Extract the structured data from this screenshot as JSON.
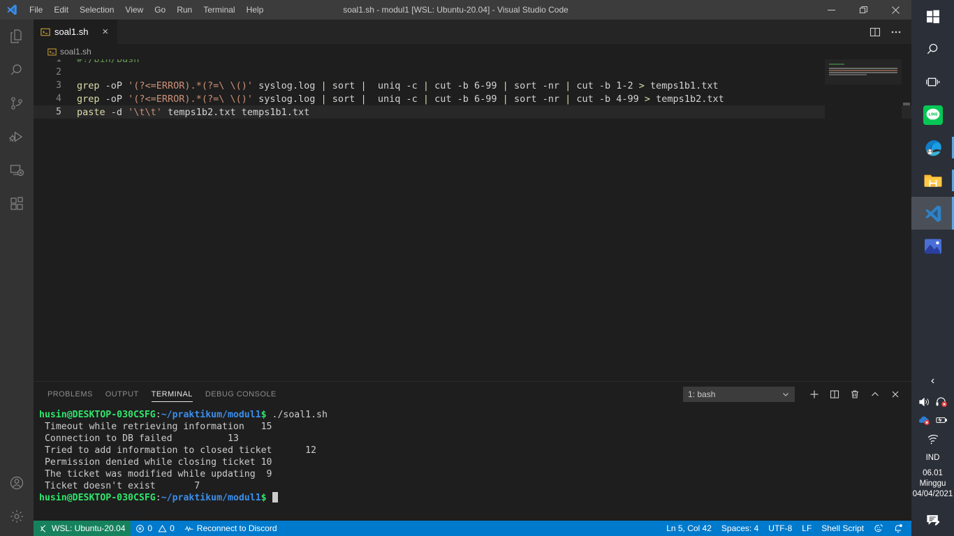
{
  "window": {
    "title": "soal1.sh - modul1 [WSL: Ubuntu-20.04] - Visual Studio Code",
    "minimize_label": "Minimize",
    "maximize_label": "Restore",
    "close_label": "Close"
  },
  "menu": {
    "items": [
      {
        "label": "File"
      },
      {
        "label": "Edit"
      },
      {
        "label": "Selection"
      },
      {
        "label": "View"
      },
      {
        "label": "Go"
      },
      {
        "label": "Run"
      },
      {
        "label": "Terminal"
      },
      {
        "label": "Help"
      }
    ]
  },
  "activity_bar": {
    "items": [
      {
        "name": "explorer-icon",
        "label": "Explorer"
      },
      {
        "name": "search-icon",
        "label": "Search"
      },
      {
        "name": "source-control-icon",
        "label": "Source Control"
      },
      {
        "name": "run-and-debug-icon",
        "label": "Run and Debug"
      },
      {
        "name": "remote-explorer-icon",
        "label": "Remote Explorer"
      },
      {
        "name": "extensions-icon",
        "label": "Extensions"
      }
    ],
    "bottom": [
      {
        "name": "accounts-icon",
        "label": "Accounts"
      },
      {
        "name": "manage-icon",
        "label": "Manage"
      }
    ]
  },
  "tabs": [
    {
      "label": "soal1.sh",
      "icon": "shell-script-icon",
      "close": "×",
      "active": true
    }
  ],
  "editor_actions": {
    "split_label": "Split Editor",
    "more_label": "More Actions..."
  },
  "breadcrumb": {
    "items": [
      {
        "label": "soal1.sh",
        "icon": "shell-script-icon"
      }
    ]
  },
  "code": {
    "language": "Shell Script",
    "lines": [
      {
        "n": "1",
        "current": false,
        "tokens": [
          {
            "t": "#!/bin/bash",
            "c": "k-com"
          }
        ]
      },
      {
        "n": "2",
        "current": false,
        "tokens": [
          {
            "t": "",
            "c": "k-plain"
          }
        ]
      },
      {
        "n": "3",
        "current": false,
        "tokens": [
          {
            "t": "grep",
            "c": "k-cmd"
          },
          {
            "t": " -oP ",
            "c": "k-plain"
          },
          {
            "t": "'(?<=ERROR).*(?=\\ \\()'",
            "c": "k-str"
          },
          {
            "t": " syslog.log ",
            "c": "k-plain"
          },
          {
            "t": "|",
            "c": "k-pipe"
          },
          {
            "t": " sort ",
            "c": "k-plain"
          },
          {
            "t": "|",
            "c": "k-pipe"
          },
          {
            "t": "  uniq -c ",
            "c": "k-plain"
          },
          {
            "t": "|",
            "c": "k-pipe"
          },
          {
            "t": " cut -b 6-99 ",
            "c": "k-plain"
          },
          {
            "t": "|",
            "c": "k-pipe"
          },
          {
            "t": " sort -nr ",
            "c": "k-plain"
          },
          {
            "t": "|",
            "c": "k-pipe"
          },
          {
            "t": " cut -b 1-2 ",
            "c": "k-plain"
          },
          {
            "t": ">",
            "c": "k-pipe"
          },
          {
            "t": " temps1b1.txt",
            "c": "k-plain"
          }
        ]
      },
      {
        "n": "4",
        "current": false,
        "tokens": [
          {
            "t": "grep",
            "c": "k-cmd"
          },
          {
            "t": " -oP ",
            "c": "k-plain"
          },
          {
            "t": "'(?<=ERROR).*(?=\\ \\()'",
            "c": "k-str"
          },
          {
            "t": " syslog.log ",
            "c": "k-plain"
          },
          {
            "t": "|",
            "c": "k-pipe"
          },
          {
            "t": " sort ",
            "c": "k-plain"
          },
          {
            "t": "|",
            "c": "k-pipe"
          },
          {
            "t": "  uniq -c ",
            "c": "k-plain"
          },
          {
            "t": "|",
            "c": "k-pipe"
          },
          {
            "t": " cut -b 6-99 ",
            "c": "k-plain"
          },
          {
            "t": "|",
            "c": "k-pipe"
          },
          {
            "t": " sort -nr ",
            "c": "k-plain"
          },
          {
            "t": "|",
            "c": "k-pipe"
          },
          {
            "t": " cut -b 4-99 ",
            "c": "k-plain"
          },
          {
            "t": ">",
            "c": "k-pipe"
          },
          {
            "t": " temps1b2.txt",
            "c": "k-plain"
          }
        ]
      },
      {
        "n": "5",
        "current": true,
        "tokens": [
          {
            "t": "paste",
            "c": "k-cmd"
          },
          {
            "t": " -d ",
            "c": "k-plain"
          },
          {
            "t": "'\\t\\t'",
            "c": "k-str"
          },
          {
            "t": " temps1b2.txt temps1b1.txt",
            "c": "k-plain"
          }
        ]
      }
    ]
  },
  "panel": {
    "tabs": [
      {
        "label": "PROBLEMS",
        "active": false
      },
      {
        "label": "OUTPUT",
        "active": false
      },
      {
        "label": "TERMINAL",
        "active": true
      },
      {
        "label": "DEBUG CONSOLE",
        "active": false
      }
    ],
    "terminal_select": {
      "value": "1: bash",
      "chevron": "˅"
    },
    "actions": [
      {
        "name": "new-terminal-button",
        "label": "New Terminal"
      },
      {
        "name": "split-terminal-button",
        "label": "Split Terminal"
      },
      {
        "name": "kill-terminal-button",
        "label": "Kill Terminal"
      },
      {
        "name": "maximize-panel-button",
        "label": "Maximize Panel Size"
      },
      {
        "name": "close-panel-button",
        "label": "Close Panel"
      }
    ]
  },
  "terminal": {
    "prompt": {
      "user_host": "husin@DESKTOP-030CSFG",
      "colon": ":",
      "path": "~/praktikum/modul1",
      "dollar": "$"
    },
    "command": " ./soal1.sh",
    "output_lines": [
      " Timeout while retrieving information\t15",
      " Connection to DB failed\t\t13",
      " Tried to add information to closed ticket\t12",
      " Permission denied while closing ticket\t10",
      " The ticket was modified while updating\t9",
      " Ticket doesn't exist\t\t7"
    ],
    "output_rendered": [
      " Timeout while retrieving information   15",
      " Connection to DB failed          13",
      " Tried to add information to closed ticket      12",
      " Permission denied while closing ticket 10",
      " The ticket was modified while updating  9",
      " Ticket doesn't exist       7"
    ]
  },
  "statusbar": {
    "remote": {
      "label": "WSL: Ubuntu-20.04",
      "icon": "remote-window-icon"
    },
    "problems": {
      "errors": "0",
      "warnings": "0",
      "error_icon": "error-circle-icon",
      "warning_icon": "warning-triangle-icon"
    },
    "discord": {
      "label": "Reconnect to Discord",
      "icon": "pulse-icon"
    },
    "right": [
      {
        "name": "editor-position",
        "label": "Ln 5, Col 42"
      },
      {
        "name": "indentation",
        "label": "Spaces: 4"
      },
      {
        "name": "encoding",
        "label": "UTF-8"
      },
      {
        "name": "eol",
        "label": "LF"
      },
      {
        "name": "language-mode",
        "label": "Shell Script"
      }
    ],
    "feedback_icon": "feedback-smiley-icon",
    "bell_icon": "bell-dot-icon",
    "colors": {
      "remote_bg": "#16825d",
      "bar_bg": "#007acc"
    }
  },
  "taskbar": {
    "items": [
      {
        "name": "start-button",
        "label": "Start"
      },
      {
        "name": "search-button",
        "label": "Search"
      },
      {
        "name": "task-view-button",
        "label": "Task View"
      },
      {
        "name": "line-app-button",
        "label": "LINE"
      },
      {
        "name": "microsoft-edge-button",
        "label": "Microsoft Edge"
      },
      {
        "name": "file-explorer-button",
        "label": "File Explorer"
      },
      {
        "name": "visual-studio-code-button",
        "label": "Visual Studio Code"
      },
      {
        "name": "photos-button",
        "label": "Photos"
      }
    ],
    "tray": {
      "chevron": "‹",
      "icons": [
        {
          "name": "volume-icon",
          "label": "Volume"
        },
        {
          "name": "headset-muted-icon",
          "label": "Headset disconnected"
        },
        {
          "name": "onedrive-error-icon",
          "label": "OneDrive"
        },
        {
          "name": "battery-icon",
          "label": "Battery"
        },
        {
          "name": "wifi-icon",
          "label": "Network"
        }
      ],
      "language": "IND",
      "clock": {
        "time": "06.01",
        "day": "Minggu",
        "date": "04/04/2021"
      },
      "action_center": {
        "name": "action-center-icon",
        "label": "Notifications"
      }
    }
  }
}
